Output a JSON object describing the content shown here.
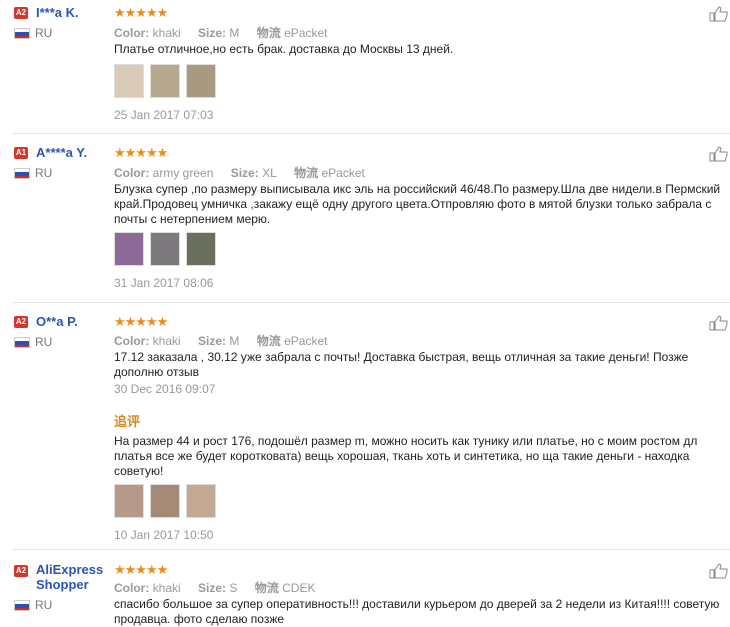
{
  "labels": {
    "color": "Color:",
    "size": "Size:",
    "shipping": "物流",
    "additional": "追评"
  },
  "reviews": [
    {
      "badge": "A2",
      "name": "I***a K.",
      "country": "RU",
      "color": "khaki",
      "size": "M",
      "ship": "ePacket",
      "text": "Платье отличное,но есть брак. доставка до Москвы 13 дней.",
      "date": "25 Jan 2017 07:03",
      "thumb_colors": [
        "#d9cbb8",
        "#b7a98e",
        "#a89a80"
      ]
    },
    {
      "badge": "A1",
      "name": "A****a Y.",
      "country": "RU",
      "color": "army green",
      "size": "XL",
      "ship": "ePacket",
      "text": "Блузка супер ,по размеру выписывала икс эль на российский 46/48.По размеру.Шла две нидели.в Пермский край.Продовец умничка ,закажу ещё одну другого цвета.Отпровляю фото в мятой блузки только забрала с почты с нетерпением мерю.",
      "date": "31 Jan 2017 08:06",
      "thumb_colors": [
        "#8c6a98",
        "#7c7a7c",
        "#6b705e"
      ]
    },
    {
      "badge": "A2",
      "name": "O**a P.",
      "country": "RU",
      "color": "khaki",
      "size": "M",
      "ship": "ePacket",
      "text": "17.12 заказала , 30.12 уже забрала с почты! Доставка быстрая, вещь отличная за такие деньги! Позже дополню отзыв",
      "date": "30 Dec 2016 09:07",
      "additional_text": "На размер 44 и рост 176, подошёл размер m, можно носить как тунику или платье, но с моим ростом дл платья все же будет коротковата) вещь хорошая, ткань хоть и синтетика, но ща такие деньги - находка советую!",
      "additional_date": "10 Jan 2017 10:50",
      "thumb_colors": [
        "#b59a8c",
        "#a58a78",
        "#c3a893"
      ]
    },
    {
      "badge": "A2",
      "name": "AliExpress Shopper",
      "country": "RU",
      "color": "khaki",
      "size": "S",
      "ship": "CDEK",
      "text": "спасибо большое за супер оперативность!!! доставили курьером до дверей за 2 недели из Китая!!!! советую продавца. фото сделаю позже"
    }
  ],
  "colors": {
    "accent": "#f08a16",
    "link": "#2a56b3",
    "badge": "#d8352a"
  }
}
